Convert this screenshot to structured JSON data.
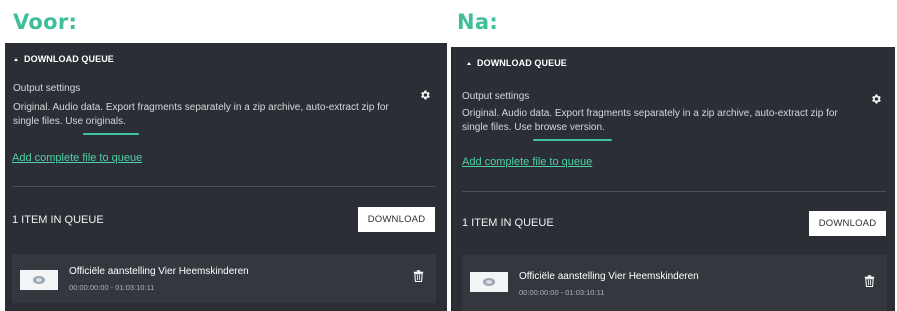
{
  "captions": {
    "before": "Voor:",
    "after": "Na:"
  },
  "before": {
    "header": "DOWNLOAD QUEUE",
    "settings_label": "Output settings",
    "settings_desc": "Original. Audio data. Export fragments separately in a zip archive, auto-extract zip for single files. Use originals.",
    "add_link": "Add complete file to queue",
    "count": "1 ITEM IN QUEUE",
    "download_btn": "DOWNLOAD",
    "item": {
      "title": "Officiële aanstelling Vier Heemskinderen",
      "time": "00:00:00:00 - 01:03:10:11"
    }
  },
  "after": {
    "header": "DOWNLOAD QUEUE",
    "settings_label": "Output settings",
    "settings_desc": "Original. Audio data. Export fragments separately in a zip archive, auto-extract zip for single files. Use browse version.",
    "add_link": "Add complete file to queue",
    "count": "1 ITEM IN QUEUE",
    "download_btn": "DOWNLOAD",
    "item": {
      "title": "Officiële aanstelling Vier Heemskinderen",
      "time": "00:00:00:00 - 01:03:10:11"
    }
  },
  "colors": {
    "panel": "#2b2f35",
    "accent": "#3fc39c",
    "caption": "#3fbf99",
    "item_bg": "#33383f"
  },
  "icons": [
    "caret-up-icon",
    "gear-icon",
    "trash-icon",
    "thumbnail-icon"
  ]
}
